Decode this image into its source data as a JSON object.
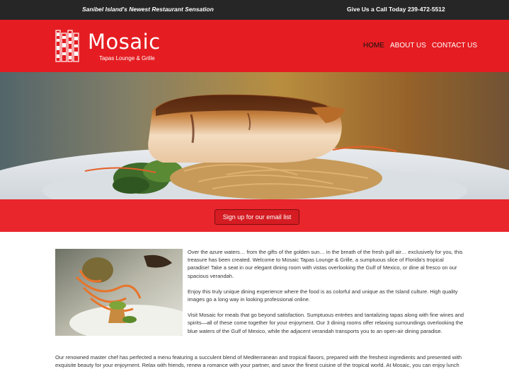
{
  "topbar": {
    "tagline": "Sanibel Island's Newest Restaurant Sensation",
    "phone": "Give Us a Call Today 239-472-5512"
  },
  "header": {
    "brand_name": "Mosaic",
    "brand_sub": "Tapas Lounge & Grille",
    "logo_icon": "mosaic-tiles-logo",
    "accent": "#e51d22"
  },
  "nav": {
    "items": [
      {
        "label": "HOME",
        "active": true
      },
      {
        "label": "ABOUT US",
        "active": false
      },
      {
        "label": "CONTACT US",
        "active": false
      }
    ]
  },
  "hero": {
    "image_desc_icon": "grilled-fish-dish-photo"
  },
  "cta": {
    "label": "Sign up for our email list"
  },
  "content": {
    "image_icon": "plated-tapas-dish-photo",
    "paragraphs": [
      "Over the azure waters… from the gifts of the golden sun… in the breath of the fresh gulf air… exclusively for you, this treasure has been created.  Welcome to Mosaic Tapas Lounge & Grille, a sumptuous slice of Florida's tropical paradise!  Take a seat in our elegant dining room with vistas overlooking the Gulf of Mexico, or dine al fresco on our spacious verandah.",
      "Enjoy this truly unique dining experience where the food is as colorful and unique as the Island culture.  High quality images go a long way in looking professional online.",
      "Visit Mosaic for meals that go beyond satisfaction. Sumptuous entrées and tantalizing tapas along with fine wines and spirits—all of these come together for your enjoyment. Our 3 dining rooms offer relaxing surroundings overlooking the blue waters of the Gulf of Mexico, while the adjacent verandah transports you to an open-air dining paradise."
    ],
    "full_paragraph": "Our renowned master chef has perfected a menu featuring a succulent blend of Mediterranean and tropical flavors, prepared with the freshest ingredients and presented with exquisite beauty for your enjoyment.  Relax with friends, renew a romance with your partner, and savor the finest cuisine of the tropical world. At Mosaic, you can enjoy lunch and"
  }
}
